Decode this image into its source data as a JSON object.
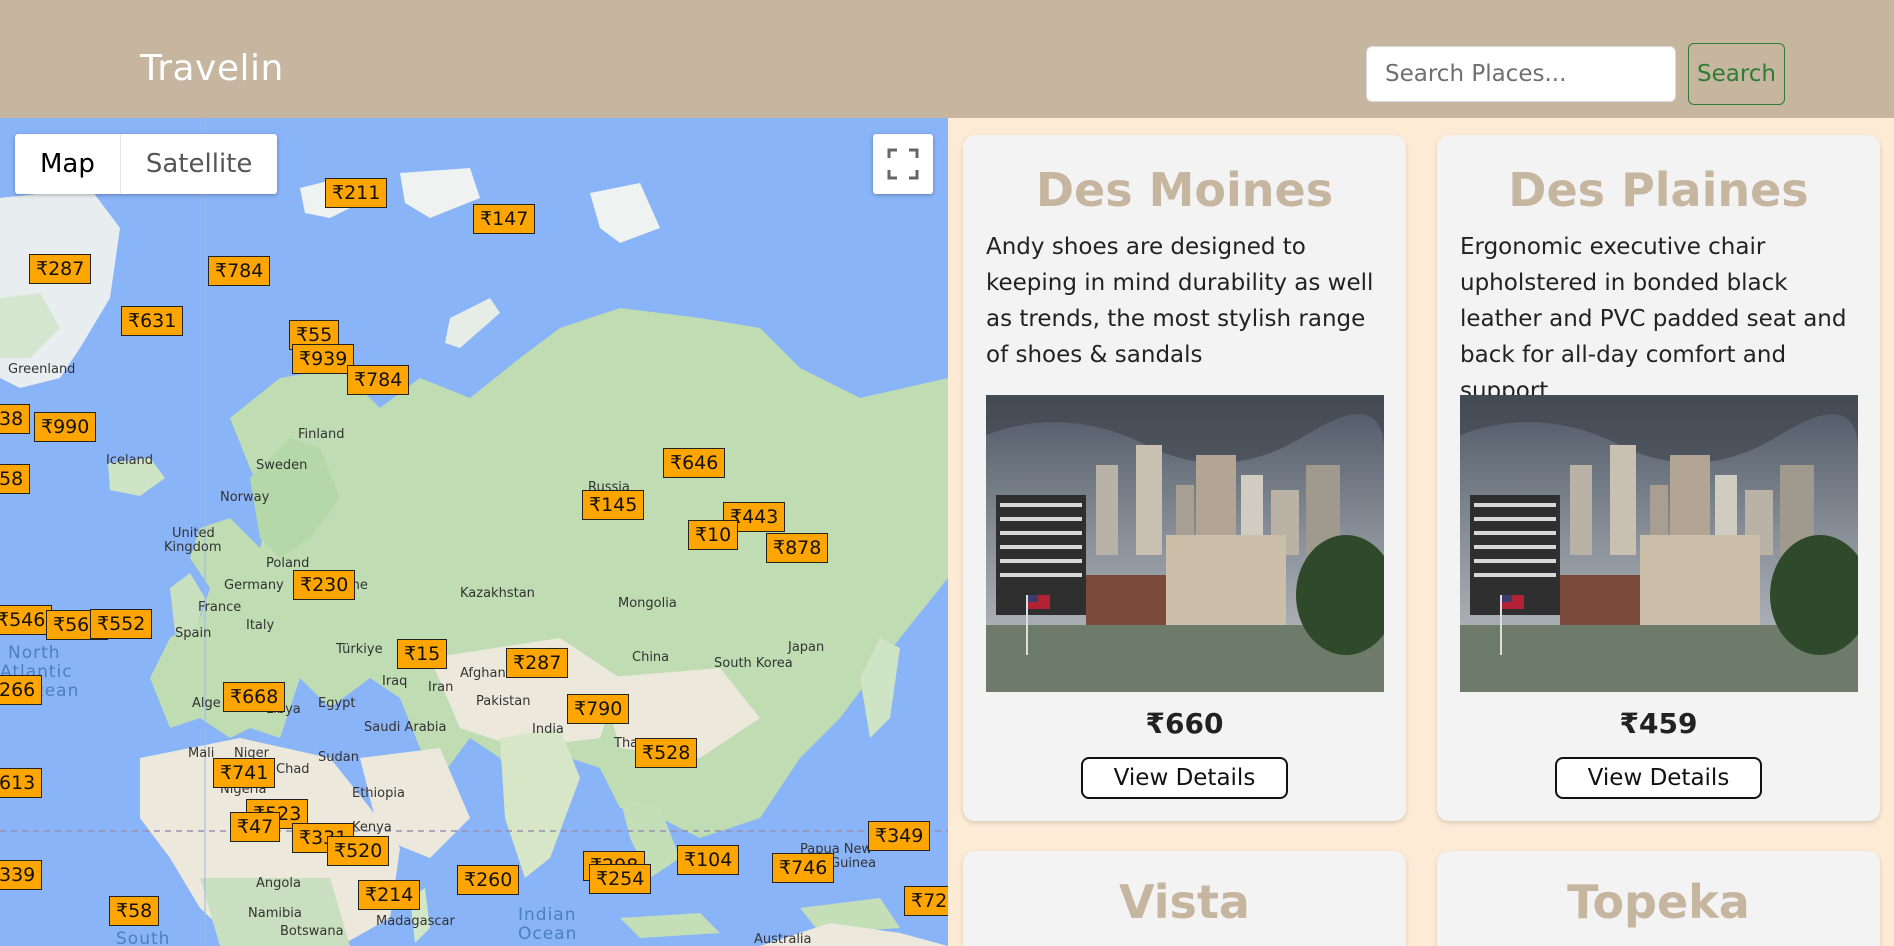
{
  "header": {
    "brand": "Travelin",
    "search_placeholder": "Search Places...",
    "search_label": "Search"
  },
  "map": {
    "type_map": "Map",
    "type_satellite": "Satellite",
    "labels": {
      "greenland": "Greenland",
      "iceland": "Iceland",
      "finland": "Finland",
      "sweden": "Sweden",
      "norway": "Norway",
      "united_kingdom_1": "United",
      "united_kingdom_2": "Kingdom",
      "poland": "Poland",
      "germany": "Germany",
      "france": "France",
      "spain": "Spain",
      "italy": "Italy",
      "ukraine": "ine",
      "turkiye": "Türkiye",
      "iraq": "Iraq",
      "iran": "Iran",
      "afghanistan": "Afghan",
      "pakistan": "Pakistan",
      "kazakhstan": "Kazakhstan",
      "mongolia": "Mongolia",
      "china": "China",
      "south_korea": "South Korea",
      "japan": "Japan",
      "india": "India",
      "thailand": "Tha",
      "russia": "Russia",
      "algeria": "Alge",
      "libya": "Libya",
      "egypt": "Egypt",
      "saudi_arabia": "Saudi Arabia",
      "mali": "Mali",
      "niger": "Niger",
      "chad": "Chad",
      "sudan": "Sudan",
      "nigeria": "Nigeria",
      "ethiopia": "Ethiopia",
      "kenya": "Kenya",
      "angola": "Angola",
      "namibia": "Namibia",
      "botswana": "Botswana",
      "madagascar": "Madagascar",
      "papua_1": "Papua New",
      "papua_2": "Guinea",
      "australia": "Australia"
    },
    "oceans": {
      "north_atlantic_1": "North",
      "north_atlantic_2": "Atlantic",
      "north_atlantic_3": "Ocean",
      "indian_1": "Indian",
      "indian_2": "Ocean",
      "south": "South"
    },
    "markers": {
      "m211": "₹211",
      "m147": "₹147",
      "m287a": "₹287",
      "m784a": "₹784",
      "m631": "₹631",
      "m55": "₹55",
      "m939": "₹939",
      "m784b": "₹784",
      "m38": "38",
      "m990": "₹990",
      "m58a": "58",
      "m646": "₹646",
      "m145": "₹145",
      "m443": "₹443",
      "m10": "₹10",
      "m878": "₹878",
      "m230": "₹230",
      "m546": "₹546",
      "m569": "₹569",
      "m552": "₹552",
      "m15": "₹15",
      "m287b": "₹287",
      "m266": "266",
      "m668": "₹668",
      "m790": "₹790",
      "m528": "₹528",
      "m741": "₹741",
      "m613": "613",
      "m523": "₹523",
      "m47": "₹47",
      "m331": "₹331",
      "m520": "₹520",
      "m349": "₹349",
      "m339": "339",
      "m260": "₹260",
      "m298": "₹298",
      "m254": "₹254",
      "m104": "₹104",
      "m746": "₹746",
      "m58b": "₹58",
      "m214": "₹214",
      "m72x": "₹72"
    }
  },
  "cards": [
    {
      "title": "Des Moines",
      "description": "Andy shoes are designed to keeping in mind durability as well as trends, the most stylish range of shoes & sandals",
      "price": "₹660",
      "button": "View Details"
    },
    {
      "title": "Des Plaines",
      "description": "Ergonomic executive chair upholstered in bonded black leather and PVC padded seat and back for all-day comfort and support",
      "price": "₹459",
      "button": "View Details"
    },
    {
      "title": "Vista"
    },
    {
      "title": "Topeka"
    }
  ]
}
